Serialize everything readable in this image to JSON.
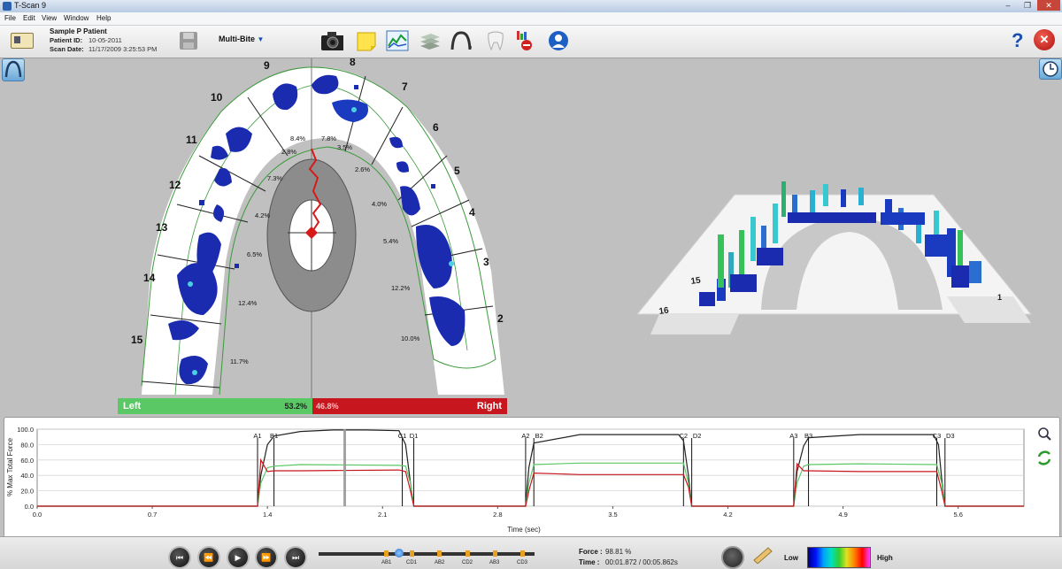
{
  "window": {
    "title": "T-Scan 9"
  },
  "menu": [
    "File",
    "Edit",
    "View",
    "Window",
    "Help"
  ],
  "patient": {
    "name": "Sample P Patient",
    "id_label": "Patient ID:",
    "id_value": "10-05-2011",
    "date_label": "Scan Date:",
    "date_value": "11/17/2009 3:25:53 PM"
  },
  "toolbar": {
    "mode": "Multi-Bite",
    "icons": [
      "patient-card-icon",
      "save-icon",
      "camera-icon",
      "note-icon",
      "graph-icon",
      "layers-icon",
      "arch-icon",
      "tooth-icon",
      "sensor-icon",
      "avatar-icon"
    ],
    "help": "?",
    "close": "✕"
  },
  "teeth": {
    "numbers": [
      "9",
      "8",
      "10",
      "7",
      "11",
      "6",
      "5",
      "12",
      "4",
      "13",
      "3",
      "14",
      "2",
      "15"
    ],
    "percents": [
      "8.4%",
      "7.8%",
      "2.8%",
      "3.5%",
      "2.6%",
      "7.3%",
      "4.0%",
      "4.2%",
      "5.4%",
      "6.5%",
      "12.2%",
      "12.4%",
      "10.0%",
      "11.7%"
    ]
  },
  "split": {
    "left_label": "Left",
    "left_pct": "53.2%",
    "right_pct": "46.8%",
    "right_label": "Right"
  },
  "colors": {
    "left": "#5bc866",
    "right": "#c8161e",
    "total": "#222222",
    "accent": "#2a55c8"
  },
  "chart_data": {
    "type": "line",
    "ylabel": "% Max Total Force",
    "xlabel": "Time (sec)",
    "xlim": [
      0.0,
      6.0
    ],
    "ylim": [
      0.0,
      100.0
    ],
    "xticks": [
      "0.0",
      "0.7",
      "1.4",
      "2.1",
      "2.8",
      "3.5",
      "4.2",
      "4.9",
      "5.6"
    ],
    "yticks": [
      "0.0",
      "20.0",
      "40.0",
      "60.0",
      "80.0",
      "100.0"
    ],
    "markers": [
      {
        "label": "A1",
        "t": 1.34
      },
      {
        "label": "B1",
        "t": 1.44
      },
      {
        "label": "C1",
        "t": 2.22
      },
      {
        "label": "D1",
        "t": 2.29
      },
      {
        "label": "A2",
        "t": 2.97
      },
      {
        "label": "B2",
        "t": 3.02
      },
      {
        "label": "C2",
        "t": 3.93
      },
      {
        "label": "D2",
        "t": 3.98
      },
      {
        "label": "A3",
        "t": 4.6
      },
      {
        "label": "B3",
        "t": 4.69
      },
      {
        "label": "C3",
        "t": 5.47
      },
      {
        "label": "D3",
        "t": 5.52
      }
    ],
    "cursor_t": 1.87,
    "series": [
      {
        "name": "total",
        "x": [
          0,
          1.34,
          1.36,
          1.4,
          1.44,
          1.6,
          1.8,
          2.0,
          2.2,
          2.24,
          2.27,
          2.29,
          2.97,
          2.99,
          3.02,
          3.3,
          3.9,
          3.93,
          3.96,
          3.98,
          4.6,
          4.62,
          4.66,
          4.69,
          5.0,
          5.45,
          5.48,
          5.5,
          5.52,
          6.0
        ],
        "y": [
          0,
          0,
          40,
          80,
          91,
          97,
          99,
          99,
          98,
          80,
          30,
          0,
          0,
          50,
          82,
          93,
          93,
          85,
          40,
          0,
          0,
          45,
          78,
          89,
          93,
          93,
          80,
          35,
          0,
          0
        ]
      },
      {
        "name": "left",
        "x": [
          0,
          1.34,
          1.36,
          1.4,
          1.44,
          1.6,
          2.2,
          2.24,
          2.27,
          2.29,
          2.97,
          2.99,
          3.02,
          3.3,
          3.93,
          3.96,
          3.98,
          4.6,
          4.62,
          4.66,
          4.69,
          5.0,
          5.47,
          5.5,
          5.52,
          6.0
        ],
        "y": [
          0,
          0,
          30,
          50,
          52,
          54,
          53,
          52,
          30,
          0,
          0,
          30,
          54,
          56,
          56,
          30,
          0,
          0,
          30,
          52,
          54,
          55,
          54,
          30,
          0,
          0
        ]
      },
      {
        "name": "right",
        "x": [
          0,
          1.34,
          1.36,
          1.4,
          1.44,
          1.6,
          2.2,
          2.24,
          2.27,
          2.29,
          2.97,
          2.99,
          3.02,
          3.3,
          3.93,
          3.96,
          3.98,
          4.6,
          4.62,
          4.66,
          4.69,
          5.0,
          5.47,
          5.5,
          5.52,
          6.0
        ],
        "y": [
          0,
          0,
          60,
          45,
          46,
          46,
          47,
          45,
          20,
          0,
          0,
          20,
          43,
          41,
          41,
          25,
          0,
          0,
          55,
          46,
          46,
          45,
          45,
          20,
          0,
          0
        ]
      }
    ]
  },
  "playback": {
    "force_label": "Force :",
    "force_value": "98.81 %",
    "time_label": "Time :",
    "time_value": "00:01.872 / 00:05.862s",
    "segments": [
      "AB1",
      "CD1",
      "AB2",
      "CD2",
      "AB3",
      "CD3"
    ],
    "low": "Low",
    "high": "High"
  }
}
